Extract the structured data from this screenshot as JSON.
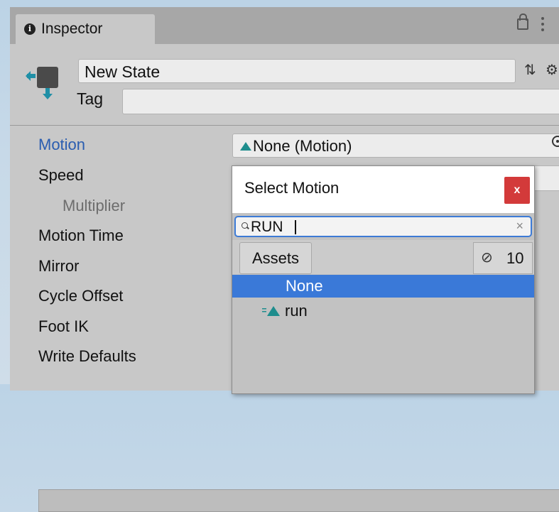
{
  "inspector": {
    "tab_title": "Inspector",
    "state_name": "New State",
    "tag_label": "Tag",
    "tag_value": ""
  },
  "properties": [
    {
      "label": "Motion",
      "active": true
    },
    {
      "label": "Speed"
    },
    {
      "label": "Multiplier"
    },
    {
      "label": "Motion Time"
    },
    {
      "label": "Mirror"
    },
    {
      "label": "Cycle Offset"
    },
    {
      "label": "Foot IK"
    },
    {
      "label": "Write Defaults"
    }
  ],
  "motion_field": {
    "value": "None (Motion)"
  },
  "picker": {
    "title": "Select Motion",
    "close_label": "x",
    "search_value": "RUN",
    "clear_label": "×",
    "assets_tab": "Assets",
    "hidden_count": "10",
    "items": [
      {
        "label": "None",
        "selected": true
      },
      {
        "label": "run",
        "selected": false
      }
    ]
  },
  "colors": {
    "accent": "#3a79d8",
    "active_label": "#2a5db0",
    "close": "#d33a3a",
    "animation_icon": "#1e8d8d"
  },
  "icons": [
    "info-icon",
    "lock-icon",
    "kebab-menu-icon",
    "animator-state-icon",
    "sliders-icon",
    "gear-icon",
    "motion-icon",
    "object-picker-icon",
    "search-icon",
    "clear-icon",
    "eye-slash-icon",
    "animation-clip-icon"
  ]
}
